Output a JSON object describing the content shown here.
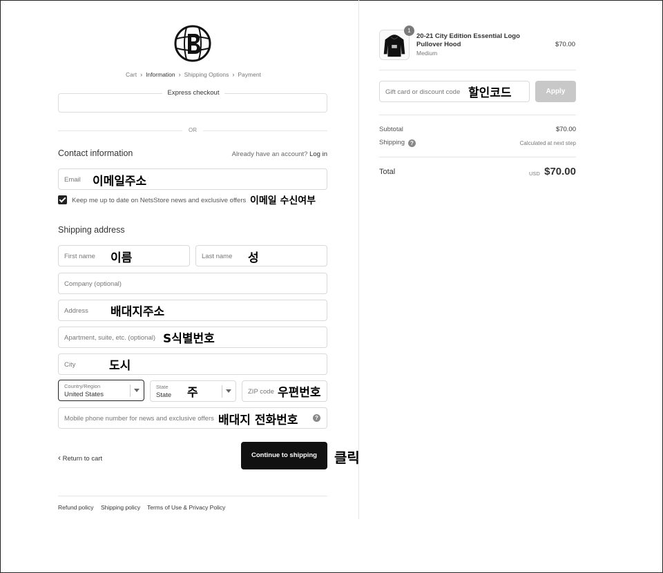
{
  "breadcrumb": {
    "cart": "Cart",
    "information": "Information",
    "shipping_options": "Shipping Options",
    "payment": "Payment",
    "separator": "›"
  },
  "express": {
    "title": "Express checkout",
    "or": "OR"
  },
  "contact": {
    "heading": "Contact information",
    "account_prompt": "Already have an account?",
    "login_link": "Log in",
    "email_placeholder": "Email",
    "email_annotation": "이메일주소",
    "newsletter_label": "Keep me up to date on NetsStore news and exclusive offers",
    "newsletter_checked": true,
    "newsletter_annotation": "이메일 수신여부"
  },
  "shipping": {
    "heading": "Shipping address",
    "first_name_placeholder": "First name",
    "first_name_annotation": "이름",
    "last_name_placeholder": "Last name",
    "last_name_annotation": "성",
    "company_placeholder": "Company (optional)",
    "address_placeholder": "Address",
    "address_annotation": "배대지주소",
    "apartment_placeholder": "Apartment, suite, etc. (optional)",
    "apartment_annotation": "S식별번호",
    "city_placeholder": "City",
    "city_annotation": "도시",
    "country_label": "Country/Region",
    "country_value": "United States",
    "state_label": "State",
    "state_value": "State",
    "state_annotation": "주",
    "zip_placeholder": "ZIP code",
    "zip_annotation": "우편번호",
    "phone_placeholder": "Mobile phone number for news and exclusive offers",
    "phone_annotation": "배대지 전화번호",
    "help_glyph": "?"
  },
  "actions": {
    "return_label": "Return to cart",
    "return_glyph": "‹",
    "continue_label": "Continue to shipping",
    "continue_annotation": "클릭"
  },
  "footer": {
    "refund": "Refund policy",
    "shipping": "Shipping policy",
    "terms": "Terms of Use & Privacy Policy"
  },
  "order": {
    "quantity": "1",
    "product_name": "20-21 City Edition Essential Logo Pullover Hood",
    "variant": "Medium",
    "price": "$70.00",
    "discount_placeholder": "Gift card or discount code",
    "discount_annotation": "할인코드",
    "apply_label": "Apply",
    "subtotal_label": "Subtotal",
    "subtotal_value": "$70.00",
    "shipping_label": "Shipping",
    "shipping_value": "Calculated at next step",
    "total_label": "Total",
    "currency": "USD",
    "total_value": "$70.00"
  },
  "icons": {
    "logo": "nets-b-logo-icon",
    "checkbox": "check-icon",
    "caret": "chevron-down-icon",
    "help": "question-circle-icon",
    "hoodie": "hoodie-icon"
  }
}
